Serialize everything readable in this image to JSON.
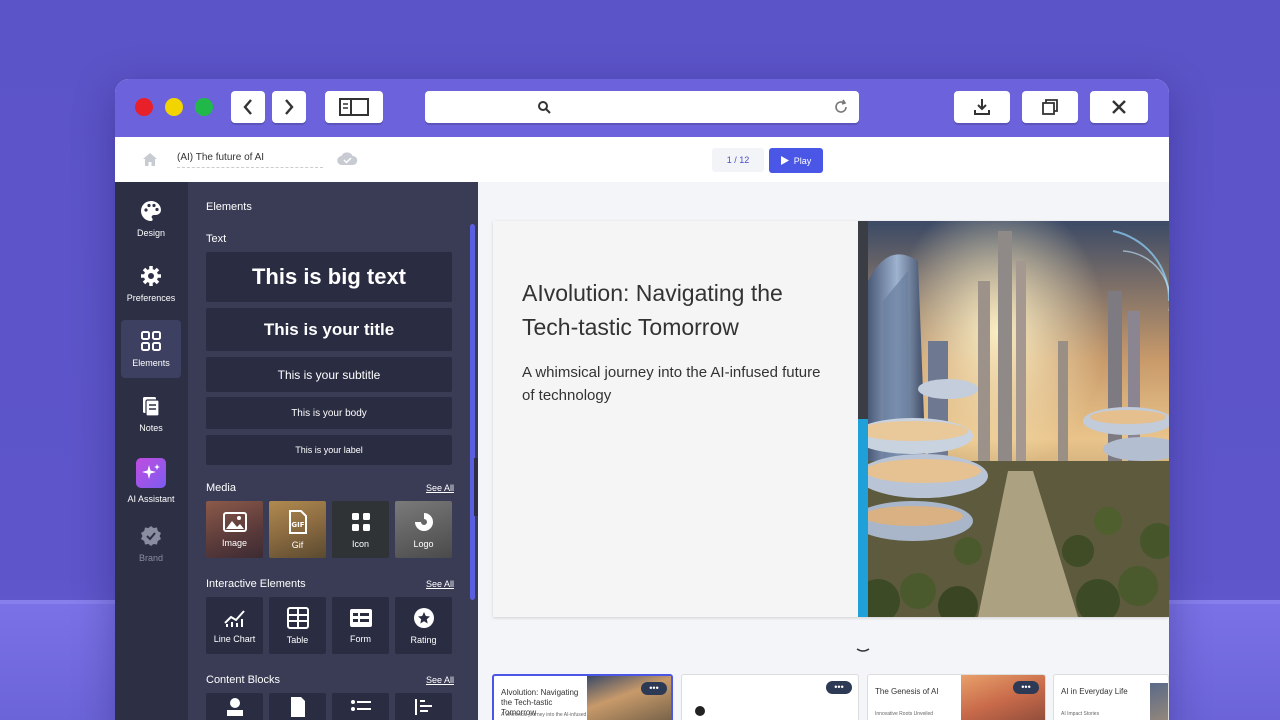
{
  "window": {
    "toolbar": {
      "back_icon": "chevron-left-icon",
      "forward_icon": "chevron-right-icon",
      "sidebar_icon": "sidebar-layout-icon",
      "search_icon": "search-icon",
      "reload_icon": "reload-icon",
      "download_icon": "download-icon",
      "restore_icon": "restore-window-icon",
      "close_icon": "close-icon"
    }
  },
  "appbar": {
    "doc_title": "(AI) The future of AI",
    "page_count": "1 / 12",
    "play_label": "Play"
  },
  "rail": {
    "items": [
      {
        "label": "Design",
        "icon": "palette-icon"
      },
      {
        "label": "Preferences",
        "icon": "gear-icon"
      },
      {
        "label": "Elements",
        "icon": "grid-icon"
      },
      {
        "label": "Notes",
        "icon": "notes-icon"
      },
      {
        "label": "AI Assistant",
        "icon": "sparkles-icon"
      },
      {
        "label": "Brand",
        "icon": "badge-icon"
      }
    ]
  },
  "panel": {
    "heading": "Elements",
    "text_section": "Text",
    "text_items": [
      "This is big text",
      "This is your title",
      "This is your subtitle",
      "This is your body",
      "This is your label"
    ],
    "media_section": "Media",
    "media_see_all": "See All",
    "media_items": [
      "Image",
      "Gif",
      "Icon",
      "Logo"
    ],
    "interactive_section": "Interactive Elements",
    "interactive_see_all": "See All",
    "interactive_items": [
      "Line Chart",
      "Table",
      "Form",
      "Rating"
    ],
    "blocks_section": "Content Blocks",
    "blocks_see_all": "See All"
  },
  "slide": {
    "title": "AIvolution: Navigating the Tech-tastic Tomorrow",
    "subtitle": "A whimsical journey into the AI-infused future of technology",
    "accent_colors": {
      "dark": "#3a3d44",
      "blue": "#1fa0d8"
    }
  },
  "thumbnails": [
    {
      "title": "AIvolution: Navigating the Tech-tastic Tomorrow",
      "sub": "A whimsical journey into the AI-infused future of technology"
    },
    {
      "title": "",
      "sub": ""
    },
    {
      "title": "The Genesis of AI",
      "sub": "Innovative Roots Unveiled"
    },
    {
      "title": "AI in Everyday Life",
      "sub": "AI Impact Stories"
    }
  ],
  "more_label": "•••",
  "colors": {
    "accent": "#4a57e6",
    "titlebar": "#6c63dc",
    "panel": "#3a3c55",
    "rail": "#2d2f45"
  }
}
